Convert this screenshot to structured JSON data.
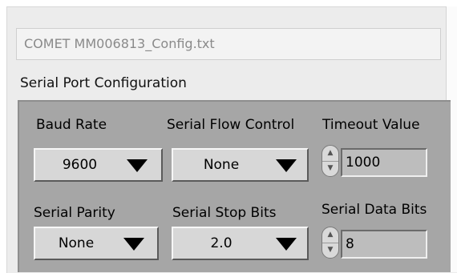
{
  "config_file": {
    "value": "COMET MM006813_Config.txt"
  },
  "section": {
    "title": "Serial Port Configuration"
  },
  "controls": {
    "baud_rate": {
      "label": "Baud Rate",
      "value": "9600"
    },
    "flow_control": {
      "label": "Serial Flow Control",
      "value": "None"
    },
    "timeout": {
      "label": "Timeout Value",
      "value": "1000"
    },
    "parity": {
      "label": "Serial Parity",
      "value": "None"
    },
    "stop_bits": {
      "label": "Serial Stop Bits",
      "value": "2.0"
    },
    "data_bits": {
      "label": "Serial Data Bits",
      "value": "8"
    }
  },
  "icons": {
    "dropdown": "triangle-down-icon",
    "stepper": "increment-decrement-icon"
  },
  "colors": {
    "panel": "#a6a6a6",
    "control_face": "#d7d7d7",
    "numeric_field": "#bdbdbd"
  }
}
